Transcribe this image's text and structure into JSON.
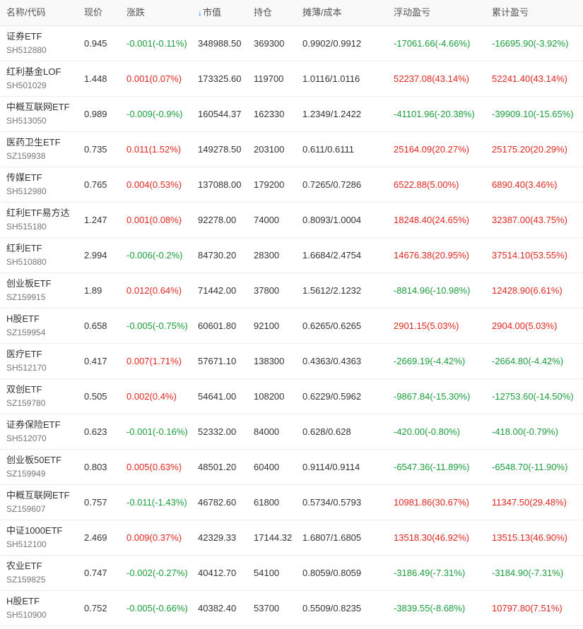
{
  "table": {
    "headers": {
      "name": "名称/代码",
      "price": "现价",
      "change": "涨跌",
      "market_value": "市值",
      "holdings": "持仓",
      "cost": "摊薄/成本",
      "floating_pnl": "浮动盈亏",
      "accumulated_pnl": "累计盈亏"
    },
    "sort_indicator": "↓",
    "colors": {
      "up": "#e0271f",
      "down": "#1c9d3c",
      "sort": "#2d7ad6"
    },
    "rows": [
      {
        "name": "证券ETF",
        "code": "SH512880",
        "price": "0.945",
        "change": "-0.001(-0.11%)",
        "market_value": "348988.50",
        "holdings": "369300",
        "cost": "0.9902/0.9912",
        "floating_pnl": "-17061.66(-4.66%)",
        "accumulated_pnl": "-16695.90(-3.92%)"
      },
      {
        "name": "红利基金LOF",
        "code": "SH501029",
        "price": "1.448",
        "change": "0.001(0.07%)",
        "market_value": "173325.60",
        "holdings": "119700",
        "cost": "1.0116/1.0116",
        "floating_pnl": "52237.08(43.14%)",
        "accumulated_pnl": "52241.40(43.14%)"
      },
      {
        "name": "中概互联网ETF",
        "code": "SH513050",
        "price": "0.989",
        "change": "-0.009(-0.9%)",
        "market_value": "160544.37",
        "holdings": "162330",
        "cost": "1.2349/1.2422",
        "floating_pnl": "-41101.96(-20.38%)",
        "accumulated_pnl": "-39909.10(-15.65%)"
      },
      {
        "name": "医药卫生ETF",
        "code": "SZ159938",
        "price": "0.735",
        "change": "0.011(1.52%)",
        "market_value": "149278.50",
        "holdings": "203100",
        "cost": "0.611/0.6111",
        "floating_pnl": "25164.09(20.27%)",
        "accumulated_pnl": "25175.20(20.29%)"
      },
      {
        "name": "传媒ETF",
        "code": "SH512980",
        "price": "0.765",
        "change": "0.004(0.53%)",
        "market_value": "137088.00",
        "holdings": "179200",
        "cost": "0.7265/0.7286",
        "floating_pnl": "6522.88(5.00%)",
        "accumulated_pnl": "6890.40(3.46%)"
      },
      {
        "name": "红利ETF易方达",
        "code": "SH515180",
        "price": "1.247",
        "change": "0.001(0.08%)",
        "market_value": "92278.00",
        "holdings": "74000",
        "cost": "0.8093/1.0004",
        "floating_pnl": "18248.40(24.65%)",
        "accumulated_pnl": "32387.00(43.75%)"
      },
      {
        "name": "红利ETF",
        "code": "SH510880",
        "price": "2.994",
        "change": "-0.006(-0.2%)",
        "market_value": "84730.20",
        "holdings": "28300",
        "cost": "1.6684/2.4754",
        "floating_pnl": "14676.38(20.95%)",
        "accumulated_pnl": "37514.10(53.55%)"
      },
      {
        "name": "创业板ETF",
        "code": "SZ159915",
        "price": "1.89",
        "change": "0.012(0.64%)",
        "market_value": "71442.00",
        "holdings": "37800",
        "cost": "1.5612/2.1232",
        "floating_pnl": "-8814.96(-10.98%)",
        "accumulated_pnl": "12428.90(6.61%)"
      },
      {
        "name": "H股ETF",
        "code": "SZ159954",
        "price": "0.658",
        "change": "-0.005(-0.75%)",
        "market_value": "60601.80",
        "holdings": "92100",
        "cost": "0.6265/0.6265",
        "floating_pnl": "2901.15(5.03%)",
        "accumulated_pnl": "2904.00(5.03%)"
      },
      {
        "name": "医疗ETF",
        "code": "SH512170",
        "price": "0.417",
        "change": "0.007(1.71%)",
        "market_value": "57671.10",
        "holdings": "138300",
        "cost": "0.4363/0.4363",
        "floating_pnl": "-2669.19(-4.42%)",
        "accumulated_pnl": "-2664.80(-4.42%)"
      },
      {
        "name": "双创ETF",
        "code": "SZ159780",
        "price": "0.505",
        "change": "0.002(0.4%)",
        "market_value": "54641.00",
        "holdings": "108200",
        "cost": "0.6229/0.5962",
        "floating_pnl": "-9867.84(-15.30%)",
        "accumulated_pnl": "-12753.60(-14.50%)"
      },
      {
        "name": "证券保险ETF",
        "code": "SH512070",
        "price": "0.623",
        "change": "-0.001(-0.16%)",
        "market_value": "52332.00",
        "holdings": "84000",
        "cost": "0.628/0.628",
        "floating_pnl": "-420.00(-0.80%)",
        "accumulated_pnl": "-418.00(-0.79%)"
      },
      {
        "name": "创业板50ETF",
        "code": "SZ159949",
        "price": "0.803",
        "change": "0.005(0.63%)",
        "market_value": "48501.20",
        "holdings": "60400",
        "cost": "0.9114/0.9114",
        "floating_pnl": "-6547.36(-11.89%)",
        "accumulated_pnl": "-6548.70(-11.90%)"
      },
      {
        "name": "中概互联网ETF",
        "code": "SZ159607",
        "price": "0.757",
        "change": "-0.011(-1.43%)",
        "market_value": "46782.60",
        "holdings": "61800",
        "cost": "0.5734/0.5793",
        "floating_pnl": "10981.86(30.67%)",
        "accumulated_pnl": "11347.50(29.48%)"
      },
      {
        "name": "中证1000ETF",
        "code": "SH512100",
        "price": "2.469",
        "change": "0.009(0.37%)",
        "market_value": "42329.33",
        "holdings": "17144.32",
        "cost": "1.6807/1.6805",
        "floating_pnl": "13518.30(46.92%)",
        "accumulated_pnl": "13515.13(46.90%)"
      },
      {
        "name": "农业ETF",
        "code": "SZ159825",
        "price": "0.747",
        "change": "-0.002(-0.27%)",
        "market_value": "40412.70",
        "holdings": "54100",
        "cost": "0.8059/0.8059",
        "floating_pnl": "-3186.49(-7.31%)",
        "accumulated_pnl": "-3184.90(-7.31%)"
      },
      {
        "name": "H股ETF",
        "code": "SH510900",
        "price": "0.752",
        "change": "-0.005(-0.66%)",
        "market_value": "40382.40",
        "holdings": "53700",
        "cost": "0.5509/0.8235",
        "floating_pnl": "-3839.55(-8.68%)",
        "accumulated_pnl": "10797.80(7.51%)"
      }
    ]
  }
}
